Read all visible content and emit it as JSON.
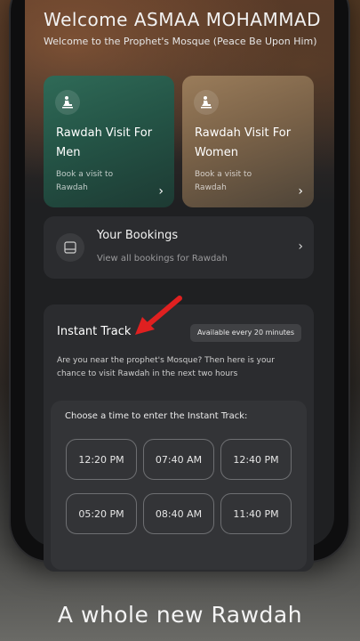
{
  "header": {
    "title": "Welcome ASMAA MOHAMMAD",
    "subtitle": "Welcome to the Prophet's Mosque (Peace Be Upon Him)"
  },
  "cards": [
    {
      "title": "Rawdah Visit For Men",
      "description": "Book a visit to Rawdah",
      "icon": "praying-person-icon",
      "color": "#2f6a57"
    },
    {
      "title": "Rawdah Visit For Women",
      "description": "Book a visit to Rawdah",
      "icon": "praying-person-icon",
      "color": "#9a7c5a"
    }
  ],
  "bookings": {
    "title": "Your Bookings",
    "subtitle": "View all bookings for Rawdah",
    "icon": "bookings-icon"
  },
  "instant_track": {
    "title": "Instant Track",
    "badge": "Available every 20 minutes",
    "description": "Are you near the prophet's Mosque? Then here is your chance to visit Rawdah in the next two hours",
    "choose_label": "Choose a time to enter the Instant Track:",
    "slots": [
      "12:20 PM",
      "07:40 AM",
      "12:40 PM",
      "05:20 PM",
      "08:40 AM",
      "11:40 PM"
    ]
  },
  "annotation": {
    "arrow_color": "#e02020"
  },
  "tagline": "A whole new Rawdah"
}
